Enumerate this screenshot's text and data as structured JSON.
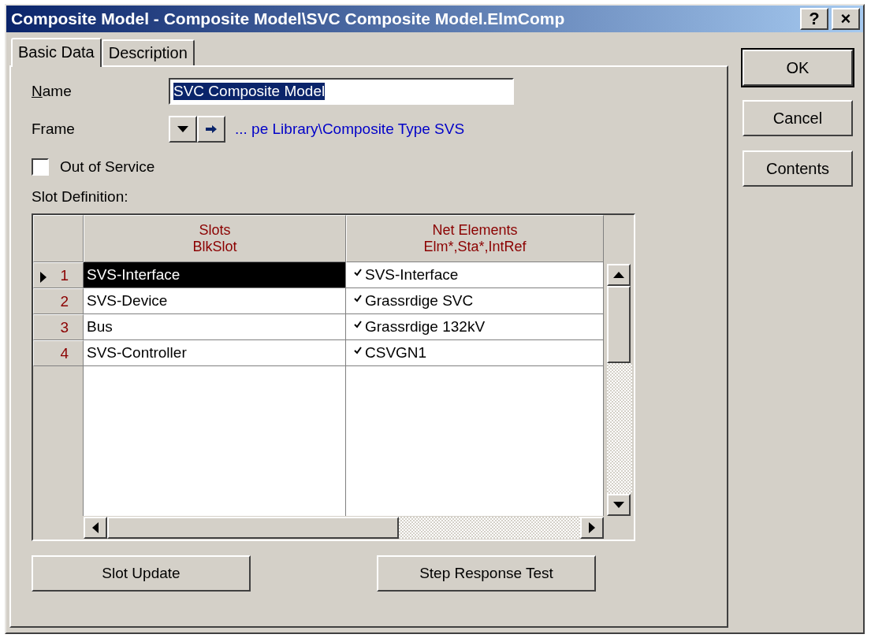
{
  "window": {
    "title": "Composite Model - Composite Model\\SVC Composite Model.ElmComp",
    "help_button": "?",
    "close_button": "×"
  },
  "tabs": [
    {
      "label": "Basic Data",
      "selected": true
    },
    {
      "label": "Description",
      "selected": false
    }
  ],
  "form": {
    "name_label": "Name",
    "name_value": "SVC Composite Model",
    "frame_label": "Frame",
    "frame_link": "... pe Library\\Composite Type SVS",
    "out_of_service": {
      "label": "Out of Service",
      "checked": false
    },
    "slot_definition_label": "Slot Definition:"
  },
  "table": {
    "columns": [
      {
        "title": "Slots",
        "subtitle": "BlkSlot"
      },
      {
        "title": "Net Elements",
        "subtitle": "Elm*,Sta*,IntRef"
      }
    ],
    "rows": [
      {
        "number": "1",
        "slot": "SVS-Interface",
        "element": "SVS-Interface",
        "checked": true,
        "selected": true
      },
      {
        "number": "2",
        "slot": "SVS-Device",
        "element": "Grassrdige SVC",
        "checked": true,
        "selected": false
      },
      {
        "number": "3",
        "slot": "Bus",
        "element": "Grassrdige 132kV",
        "checked": true,
        "selected": false
      },
      {
        "number": "4",
        "slot": "SVS-Controller",
        "element": "CSVGN1",
        "checked": true,
        "selected": false
      }
    ]
  },
  "bottom_buttons": [
    "Slot Update",
    "Step Response Test"
  ],
  "side_buttons": [
    {
      "label": "OK",
      "default": true
    },
    {
      "label": "Cancel",
      "default": false
    },
    {
      "label": "Contents",
      "default": false
    }
  ]
}
